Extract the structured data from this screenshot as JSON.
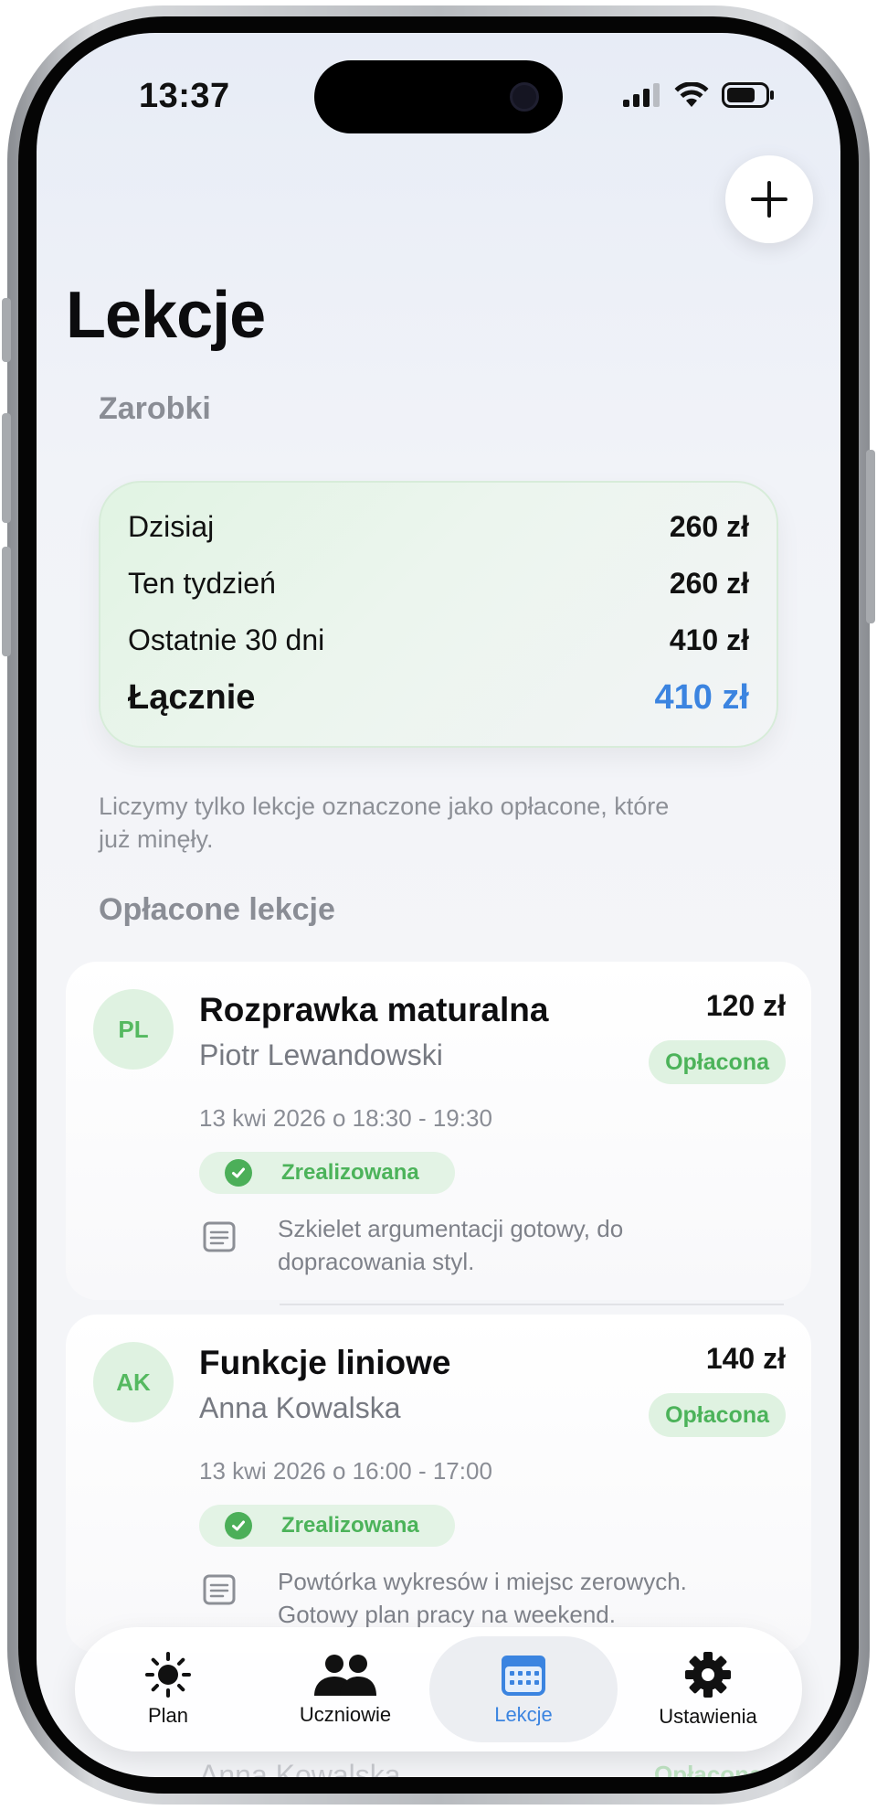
{
  "status_bar": {
    "time": "13:37"
  },
  "header": {
    "title": "Lekcje",
    "add_button": "+"
  },
  "earnings": {
    "section_label": "Zarobki",
    "rows": [
      {
        "label": "Dzisiaj",
        "value": "260 zł"
      },
      {
        "label": "Ten tydzień",
        "value": "260 zł"
      },
      {
        "label": "Ostatnie 30 dni",
        "value": "410 zł"
      }
    ],
    "total": {
      "label": "Łącznie",
      "value": "410 zł"
    },
    "note_line1": "Liczymy tylko lekcje oznaczone jako opłacone, które",
    "note_line2": "już minęły."
  },
  "paid_lessons": {
    "section_label": "Opłacone lekcje",
    "items": [
      {
        "initials": "PL",
        "title": "Rozprawka maturalna",
        "student": "Piotr Lewandowski",
        "price": "120 zł",
        "payment_badge": "Opłacona",
        "date": "13 kwi 2026 o 18:30 - 19:30",
        "status": "Zrealizowana",
        "note_line1": "Szkielet argumentacji gotowy, do",
        "note_line2": "dopracowania styl."
      },
      {
        "initials": "AK",
        "title": "Funkcje liniowe",
        "student": "Anna Kowalska",
        "price": "140 zł",
        "payment_badge": "Opłacona",
        "date": "13 kwi 2026 o 16:00 - 17:00",
        "status": "Zrealizowana",
        "note_line1": "Powtórka wykresów i miejsc zerowych.",
        "note_line2": "Gotowy plan pracy na weekend."
      }
    ],
    "partial_next": {
      "student": "Anna Kowalska",
      "payment_badge": "Opłacona"
    }
  },
  "tabbar": {
    "tabs": [
      {
        "label": "Plan",
        "icon": "sun-icon",
        "active": false
      },
      {
        "label": "Uczniowie",
        "icon": "people-icon",
        "active": false
      },
      {
        "label": "Lekcje",
        "icon": "calendar-icon",
        "active": true
      },
      {
        "label": "Ustawienia",
        "icon": "gear-icon",
        "active": false
      }
    ]
  },
  "colors": {
    "accent": "#3b84e0",
    "success": "#4caf59",
    "success_bg": "#dff2e1"
  }
}
